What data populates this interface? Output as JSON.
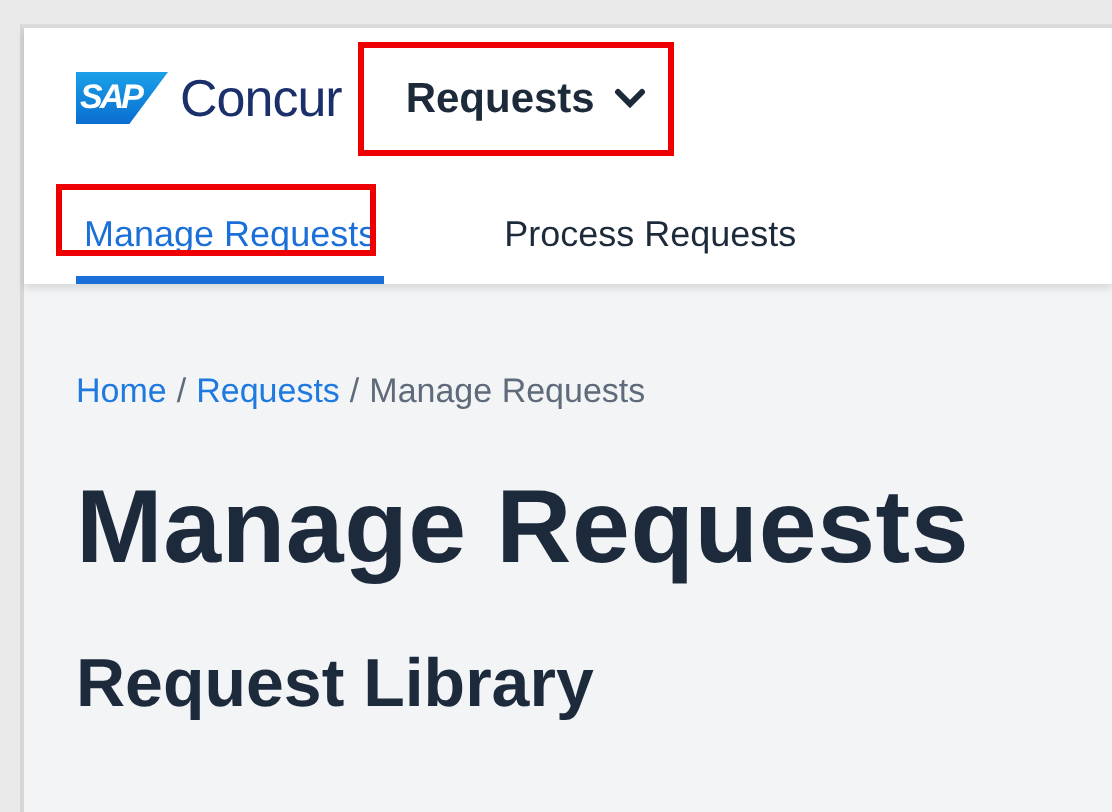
{
  "header": {
    "logo": {
      "mark": "SAP",
      "name": "Concur"
    },
    "menu": {
      "label": "Requests",
      "annotated": true
    },
    "tabs": [
      {
        "label": "Manage Requests",
        "selected": true,
        "annotated": true
      },
      {
        "label": "Process Requests",
        "selected": false,
        "annotated": false
      }
    ]
  },
  "breadcrumb": {
    "separator": "/",
    "items": [
      {
        "label": "Home",
        "link": true
      },
      {
        "label": "Requests",
        "link": true
      },
      {
        "label": "Manage Requests",
        "link": false
      }
    ]
  },
  "page_title": "Manage Requests",
  "section_title": "Request Library"
}
